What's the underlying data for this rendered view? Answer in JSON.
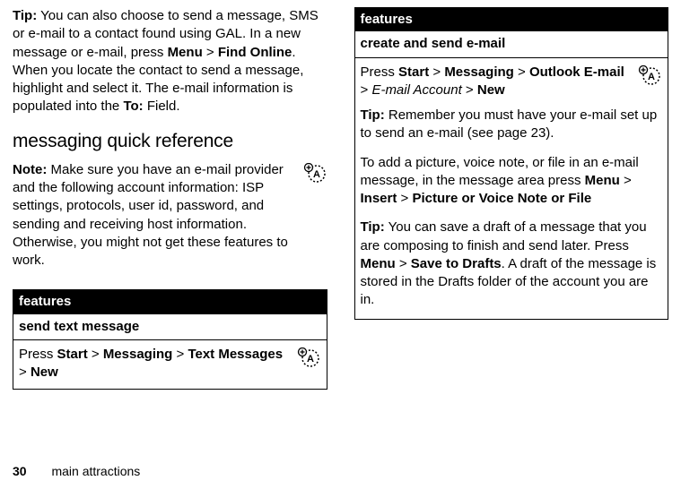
{
  "left": {
    "tip_label": "Tip:",
    "tip_body": " You can also choose to send a message, SMS or e-mail to a contact found using GAL. In a new message or e-mail, press ",
    "menu_b": "Menu",
    "gt1": " > ",
    "find_online_b": "Find Online",
    "tip_body2": ". When you locate the contact to send a message, highlight and select it. The e-mail information is populated into the ",
    "to_b": "To:",
    "tip_body3": " Field.",
    "heading": "messaging quick reference",
    "note_label": "Note:",
    "note_body": " Make sure you have an e-mail provider and the following account information: ISP settings, protocols, user id, password, and sending and receiving host information. Otherwise, you might not get these features to work.",
    "feat_header": "features",
    "feat_sub": "send text message",
    "press": "Press ",
    "start_b": "Start",
    "msg_b": "Messaging",
    "txtmsg_b": "Text Messages",
    "new_b": "New"
  },
  "right": {
    "feat_header": "features",
    "feat_sub": "create and send e-mail",
    "press": "Press ",
    "start_b": "Start",
    "msg_b": "Messaging",
    "outlook_b": "Outlook E-mail",
    "acct_i": "E-mail Account",
    "new_b": "New",
    "tip1_label": "Tip:",
    "tip1_body": " Remember you must have your e-mail set up to send an e-mail (see page 23).",
    "add_body": "To add a picture, voice note, or file in an e-mail message, in the message area press ",
    "menu_b": "Menu",
    "insert_b": "Insert",
    "pvf_b": "Picture or Voice Note or File",
    "tip2_label": "Tip:",
    "tip2_body": " You can save a draft of a message that you are composing to finish and send later. Press ",
    "save_b": "Save to Drafts",
    "tip2_body2": ". A draft of the message is stored in the Drafts folder of the account you are in."
  },
  "footer": {
    "page": "30",
    "section": "main attractions"
  }
}
